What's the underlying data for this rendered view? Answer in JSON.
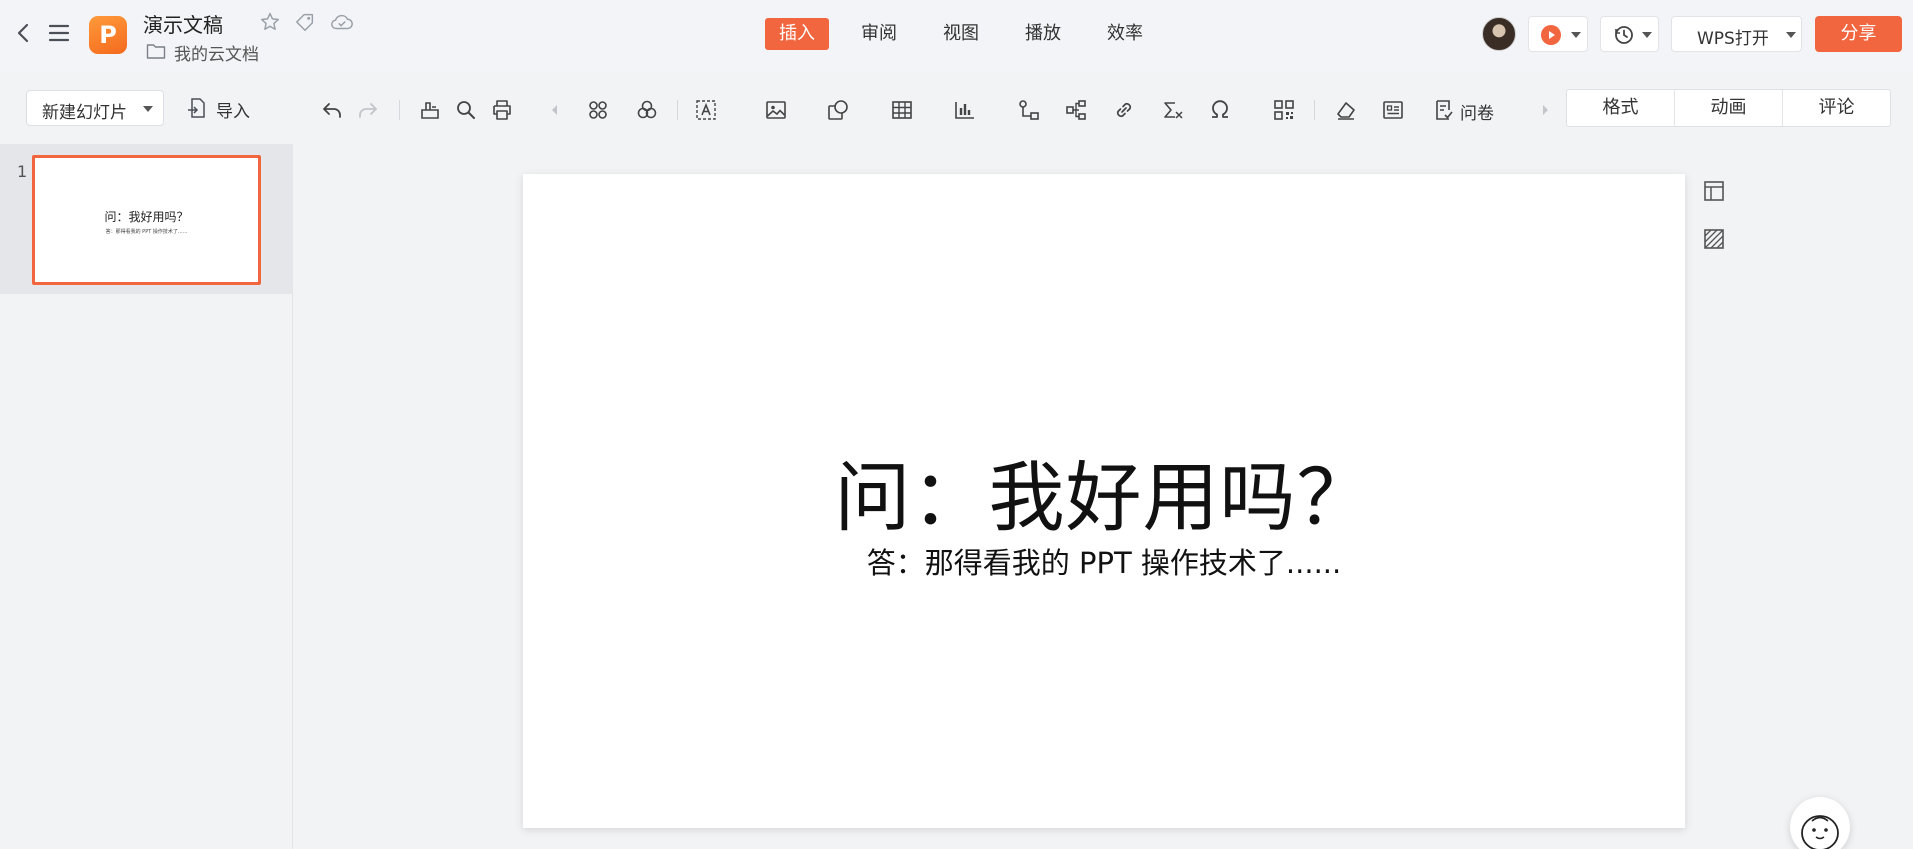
{
  "titlebar": {
    "app_logo": "P",
    "doc_title": "演示文稿",
    "doc_location": "我的云文档",
    "tabs": [
      {
        "label": "插入",
        "active": true
      },
      {
        "label": "审阅",
        "active": false
      },
      {
        "label": "视图",
        "active": false
      },
      {
        "label": "播放",
        "active": false
      },
      {
        "label": "效率",
        "active": false
      }
    ],
    "open_with": "WPS打开",
    "share": "分享"
  },
  "toolbar": {
    "new_slide": "新建幻灯片",
    "import": "导入",
    "survey": "问卷",
    "icons": [
      "undo-icon",
      "redo-icon",
      "format-painter-icon",
      "search-icon",
      "print-icon",
      "scroll-left-icon",
      "smartart-icon",
      "shapes-merge-icon",
      "textbox-icon",
      "image-icon",
      "shape-icon",
      "table-icon",
      "chart-icon",
      "flowchart-icon",
      "mindmap-icon",
      "link-icon",
      "formula-icon",
      "symbol-icon",
      "qrcode-icon",
      "clear-icon",
      "form-icon",
      "survey-icon",
      "scroll-right-icon"
    ]
  },
  "side_tabs": [
    "格式",
    "动画",
    "评论"
  ],
  "slides": [
    {
      "number": "1",
      "title": "问：我好用吗？",
      "subtitle": "答：那得看我的 PPT 操作技术了......"
    }
  ],
  "colors": {
    "accent": "#f1663f",
    "logo": "#f58a2b",
    "background": "#f2f3f5"
  }
}
